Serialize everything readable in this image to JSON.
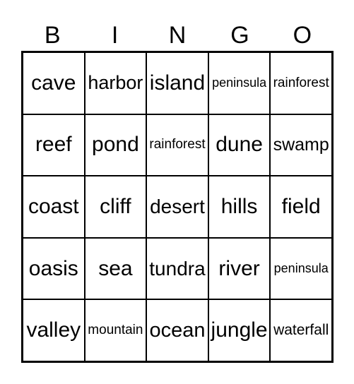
{
  "header": [
    "B",
    "I",
    "N",
    "G",
    "O"
  ],
  "rows": [
    [
      "cave",
      "harbor",
      "island",
      "peninsula",
      "rainforest"
    ],
    [
      "reef",
      "pond",
      "rainforest",
      "dune",
      "swamp"
    ],
    [
      "coast",
      "cliff",
      "desert",
      "hills",
      "field"
    ],
    [
      "oasis",
      "sea",
      "tundra",
      "river",
      "peninsula"
    ],
    [
      "valley",
      "mountain",
      "ocean",
      "jungle",
      "waterfall"
    ]
  ]
}
